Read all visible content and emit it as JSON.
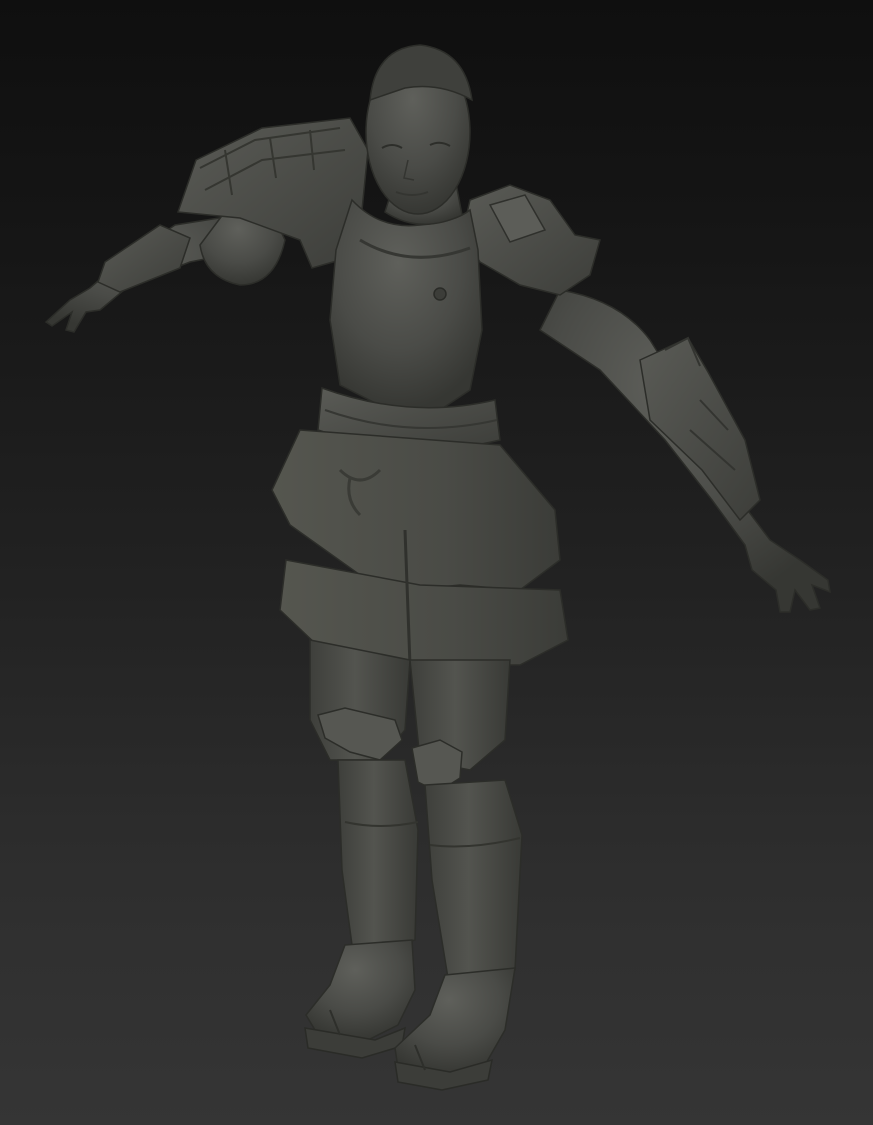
{
  "viewport": {
    "background_top": "#0f0f0f",
    "background_bottom": "#353535"
  },
  "model": {
    "material_color": "#4b4c48",
    "highlight_color": "#5e5f5a",
    "shadow_color": "#33342f"
  }
}
